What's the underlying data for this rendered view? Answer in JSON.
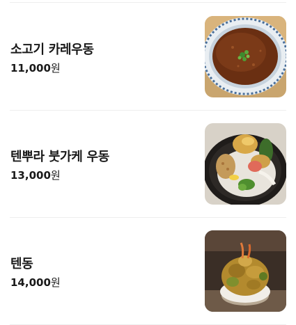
{
  "menu": {
    "items": [
      {
        "name": "소고기 카레우동",
        "price": "11,000",
        "currency_unit": "원",
        "photo": "curry-udon-photo"
      },
      {
        "name": "텐뿌라 붓가케 우동",
        "price": "13,000",
        "currency_unit": "원",
        "photo": "tempura-bukkake-udon-photo"
      },
      {
        "name": "텐동",
        "price": "14,000",
        "currency_unit": "원",
        "photo": "tendon-photo"
      }
    ]
  }
}
